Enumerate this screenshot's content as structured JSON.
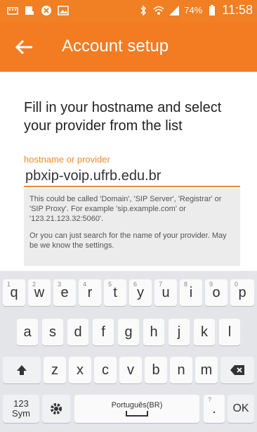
{
  "status_bar": {
    "battery_percent": "74%",
    "time": "11:58"
  },
  "header": {
    "title": "Account setup"
  },
  "form": {
    "instruction": "Fill in your hostname and select your provider from the list",
    "field_label": "hostname or provider",
    "field_value": "pbxip-voip.ufrb.edu.br",
    "help_text_1": "This could be called 'Domain', 'SIP Server', 'Registrar' or 'SIP Proxy'. For example 'sip.example.com' or '123.21.123.32:5060'.",
    "help_text_2": "Or you can just search for the name of your provider. May be we know the settings."
  },
  "keyboard": {
    "row1": [
      {
        "key": "q",
        "hint": "1"
      },
      {
        "key": "w",
        "hint": "2"
      },
      {
        "key": "e",
        "hint": "3"
      },
      {
        "key": "r",
        "hint": "4"
      },
      {
        "key": "t",
        "hint": "5"
      },
      {
        "key": "y",
        "hint": "6"
      },
      {
        "key": "u",
        "hint": "7"
      },
      {
        "key": "i",
        "hint": "8"
      },
      {
        "key": "o",
        "hint": "9"
      },
      {
        "key": "p",
        "hint": "0"
      }
    ],
    "row2": [
      "a",
      "s",
      "d",
      "f",
      "g",
      "h",
      "j",
      "k",
      "l"
    ],
    "row3": [
      "z",
      "x",
      "c",
      "v",
      "b",
      "n",
      "m"
    ],
    "sym_label": "123\nSym",
    "space_label": "Português(BR)",
    "period_label": ".",
    "ok_label": "OK",
    "period_hint": "?"
  }
}
